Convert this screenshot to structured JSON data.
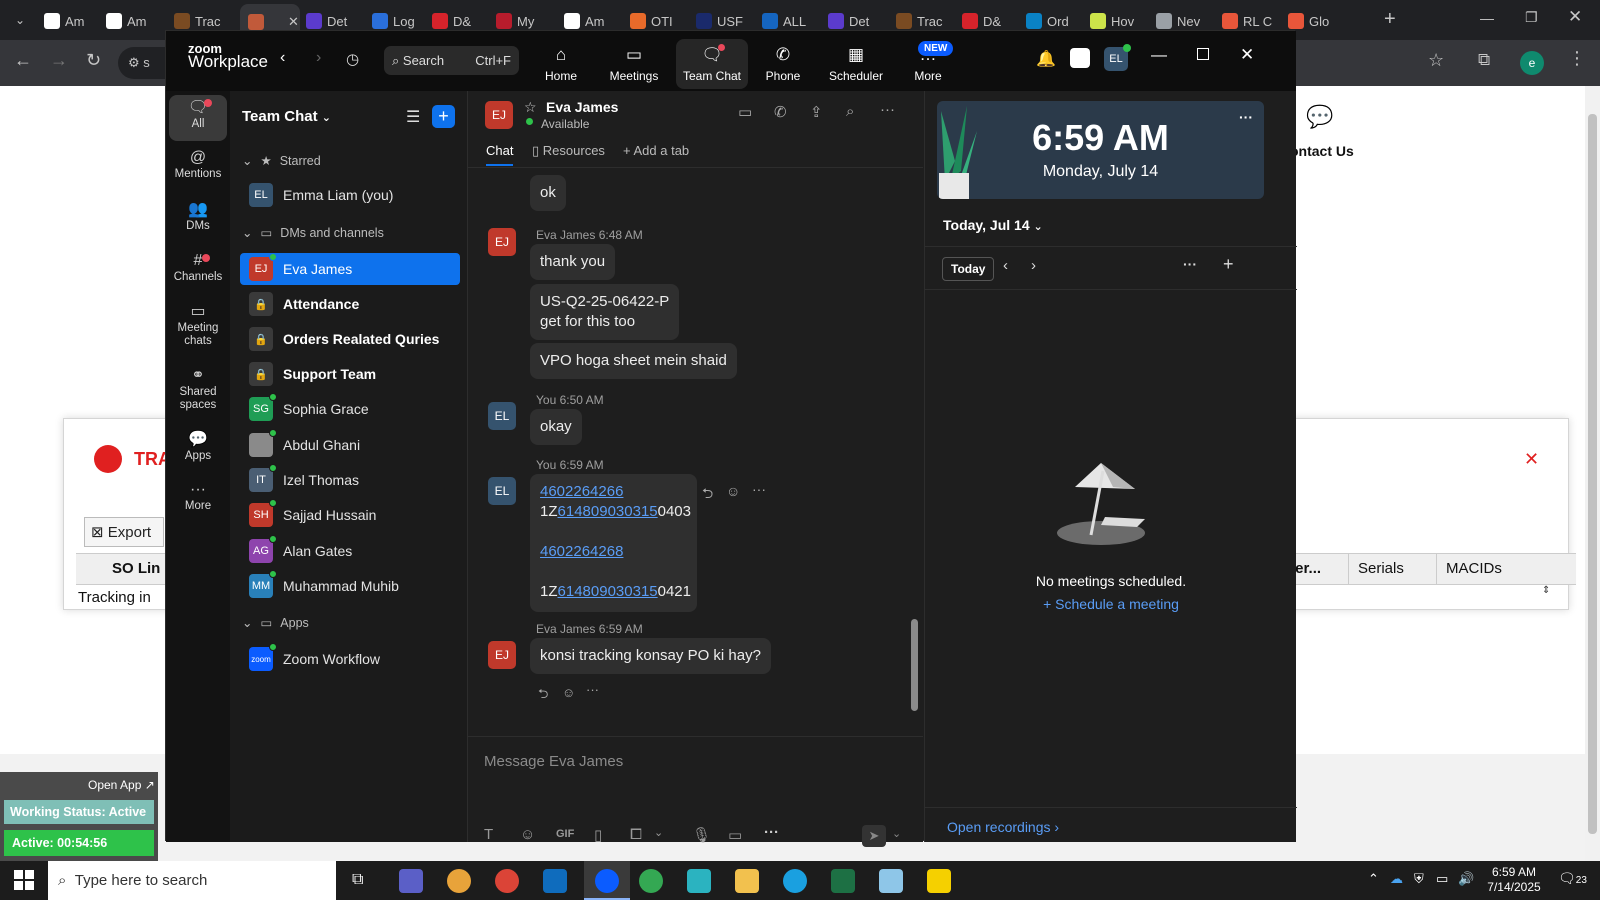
{
  "browser": {
    "tabs": [
      {
        "label": "Am",
        "color": "#ffffff"
      },
      {
        "label": "Am",
        "color": "#ffffff"
      },
      {
        "label": "Trac",
        "color": "#7a4b22"
      },
      {
        "label": "",
        "color": "#c15a3a"
      },
      {
        "label": "Det",
        "color": "#5b3bcc"
      },
      {
        "label": "Log",
        "color": "#2a6fdb"
      },
      {
        "label": "D&",
        "color": "#d6232b"
      },
      {
        "label": "My",
        "color": "#b71c2c"
      },
      {
        "label": "Am",
        "color": "#ffffff"
      },
      {
        "label": "OTI",
        "color": "#e86a2a"
      },
      {
        "label": "USF",
        "color": "#1a2a6b"
      },
      {
        "label": "ALL",
        "color": "#1565c0"
      },
      {
        "label": "Det",
        "color": "#5b3bcc"
      },
      {
        "label": "Trac",
        "color": "#7a4b22"
      },
      {
        "label": "D&",
        "color": "#d6232b"
      },
      {
        "label": "Ord",
        "color": "#0a82c5"
      },
      {
        "label": "Hov",
        "color": "#cde44a"
      },
      {
        "label": "Nev",
        "color": "#9aa0a6"
      },
      {
        "label": "RL C",
        "color": "#e8563a"
      },
      {
        "label": "Glo",
        "color": "#e8563a"
      }
    ],
    "address_partial": "s"
  },
  "background_page": {
    "contact_us": "ontact Us",
    "brand_partial": "TRA",
    "export_label": "Export",
    "so_line": "SO Lin",
    "tracking": "Tracking in",
    "col_carrier": "arrier...",
    "col_serials": "Serials",
    "col_macids": "MACIDs",
    "open_app": "Open App",
    "working_status": "Working Status: Active",
    "active_time": "Active: 00:54:56"
  },
  "zoom": {
    "brand_top": "zoom",
    "brand_bottom": "Workplace",
    "search_label": "Search",
    "search_shortcut": "Ctrl+F",
    "nav": [
      {
        "label": "Home"
      },
      {
        "label": "Meetings"
      },
      {
        "label": "Team Chat"
      },
      {
        "label": "Phone"
      },
      {
        "label": "Scheduler"
      },
      {
        "label": "More"
      }
    ],
    "new_badge": "NEW",
    "user_initials": "EL",
    "rail": [
      {
        "label": "All"
      },
      {
        "label": "Mentions"
      },
      {
        "label": "DMs"
      },
      {
        "label": "Channels"
      },
      {
        "label": "Meeting chats"
      },
      {
        "label": "Shared spaces"
      },
      {
        "label": "Apps"
      },
      {
        "label": "More"
      }
    ],
    "sidebar": {
      "title": "Team Chat",
      "starred": "Starred",
      "dms_channels": "DMs and channels",
      "apps": "Apps",
      "items": [
        {
          "name": "Emma Liam (you)",
          "initials": "EL",
          "color": "#35536e"
        },
        {
          "name": "Eva James",
          "initials": "EJ",
          "color": "#c0392b"
        },
        {
          "name": "Attendance"
        },
        {
          "name": "Orders Realated Quries"
        },
        {
          "name": "Support Team"
        },
        {
          "name": "Sophia Grace",
          "initials": "SG",
          "color": "#1f9d55"
        },
        {
          "name": "Abdul Ghani",
          "initials": "",
          "color": "#777777"
        },
        {
          "name": "Izel Thomas",
          "initials": "IT",
          "color": "#4a5e73"
        },
        {
          "name": "Sajjad Hussain",
          "initials": "SH",
          "color": "#c0392b"
        },
        {
          "name": "Alan Gates",
          "initials": "AG",
          "color": "#8e44ad"
        },
        {
          "name": "Muhammad Muhib",
          "initials": "MM",
          "color": "#2980b9"
        },
        {
          "name": "Zoom Workflow",
          "initials": "zoom",
          "color": "#0b5cff"
        }
      ]
    },
    "chat": {
      "contact_name": "Eva James",
      "contact_initials": "EJ",
      "status": "Available",
      "tabs": [
        "Chat",
        "Resources",
        "Add a tab"
      ],
      "messages": {
        "m1": "ok",
        "meta2": "Eva James 6:48 AM",
        "m2": "thank you",
        "m3a": "US-Q2-25-06422-P",
        "m3b": "get for this too",
        "m4": "VPO hoga sheet mein shaid",
        "meta5": "You 6:50 AM",
        "m5": "okay",
        "meta6": "You 6:59 AM",
        "link1": "4602264266",
        "track1_pre": "1Z",
        "track1_link": "614809030315",
        "track1_post": "0403",
        "link2": "4602264268",
        "track2_pre": "1Z",
        "track2_link": "614809030315",
        "track2_post": "0421",
        "meta7": "Eva James 6:59 AM",
        "m7": "konsi tracking konsay PO ki hay?"
      },
      "input_placeholder": "Message Eva James",
      "gif_label": "GIF"
    },
    "calendar": {
      "time": "6:59 AM",
      "date": "Monday, July 14",
      "today_label": "Today, Jul 14",
      "today_btn": "Today",
      "no_meetings": "No meetings scheduled.",
      "schedule": "Schedule a meeting",
      "open_recordings": "Open recordings"
    }
  },
  "taskbar": {
    "search_placeholder": "Type here to search",
    "time": "6:59 AM",
    "date": "7/14/2025",
    "notif_count": "23"
  }
}
